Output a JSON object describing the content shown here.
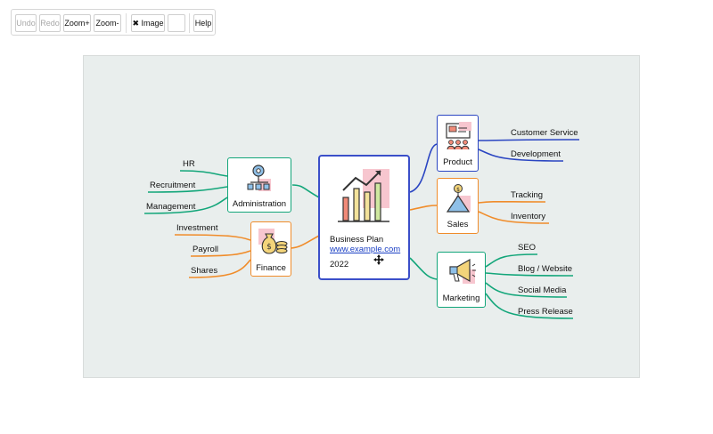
{
  "toolbar": {
    "undo": "Undo",
    "redo": "Redo",
    "zoom_in": "Zoom+",
    "zoom_out": "Zoom-",
    "image": "✖ Image",
    "blank": "",
    "help": "Help"
  },
  "central": {
    "title": "Business Plan",
    "link": "www.example.com",
    "year": "2022"
  },
  "branches": {
    "administration": {
      "label": "Administration",
      "leaves": [
        "HR",
        "Recruitment",
        "Management"
      ]
    },
    "finance": {
      "label": "Finance",
      "leaves": [
        "Investment",
        "Payroll",
        "Shares"
      ]
    },
    "product": {
      "label": "Product",
      "leaves": [
        "Customer Service",
        "Development"
      ]
    },
    "sales": {
      "label": "Sales",
      "leaves": [
        "Tracking",
        "Inventory"
      ]
    },
    "marketing": {
      "label": "Marketing",
      "leaves": [
        "SEO",
        "Blog / Website",
        "Social Media",
        "Press Release"
      ]
    }
  },
  "colors": {
    "green": "#13a67a",
    "orange": "#f08c2a",
    "blue": "#2a45c2",
    "central_border": "#3b4fc9"
  },
  "icons": {
    "central": "growth-chart-icon",
    "administration": "org-gear-icon",
    "finance": "money-bag-icon",
    "product": "presentation-icon",
    "sales": "pyramid-target-icon",
    "marketing": "megaphone-icon",
    "cursor": "move-cursor-icon"
  }
}
